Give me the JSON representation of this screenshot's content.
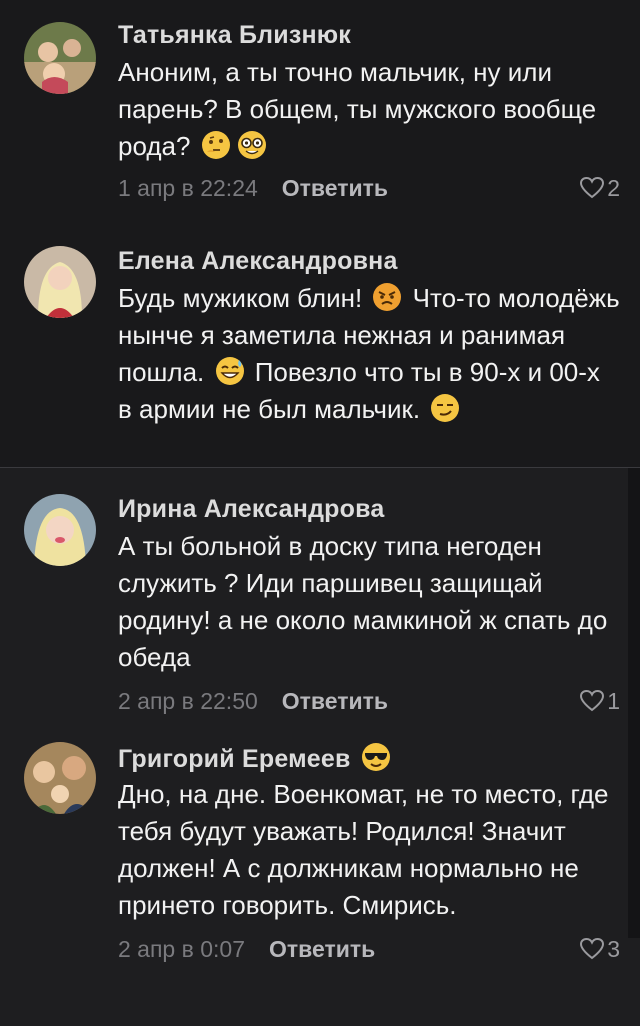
{
  "comments": [
    {
      "author": "Татьянка Близнюк",
      "segments": [
        "Аноним, а ты точно мальчик, ну или парень? В общем, ты мужского вообще рода?"
      ],
      "emojis": [
        "thinking-emoji",
        "nerd-emoji"
      ],
      "date": "1 апр в 22:24",
      "reply": "Ответить",
      "likes": "2"
    },
    {
      "author": "Елена Александровна",
      "segments": [
        "Будь мужиком блин!",
        "Что-то молодёжь нынче я заметила нежная и ранимая пошла.",
        "Повезло что ты в 90-х и 00-х в армии не был мальчик."
      ],
      "emojis": [
        "angry-emoji",
        "sweat-smile-emoji",
        "smirk-emoji"
      ]
    },
    {
      "author": "Ирина Александрова",
      "segments": [
        "А ты больной в доску типа негоден служить ? Иди паршивец защищай родину! а не около мамкиной ж спать до обеда"
      ],
      "date": "2 апр в 22:50",
      "reply": "Ответить",
      "likes": "1"
    },
    {
      "author": "Григорий Еремеев",
      "author_emoji": "sunglasses-emoji",
      "segments": [
        "Дно, на дне. Военкомат, не то место, где тебя будут уважать! Родился! Значит должен! А с должникам нормально не принето говорить. Смирись."
      ],
      "date": "2 апр в 0:07",
      "reply": "Ответить",
      "likes": "3"
    }
  ],
  "colors": {
    "background": "#1c1b1f",
    "author_text": "#dcdcdc",
    "body_text": "#f2f2f2",
    "date_text": "#7a7a7e",
    "reply_text": "#b8b8bc"
  }
}
